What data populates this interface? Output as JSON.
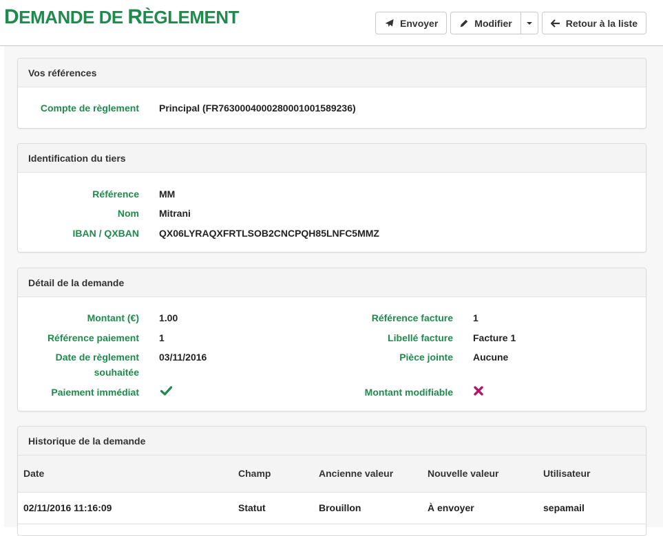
{
  "header": {
    "title_first": "D",
    "title_rest": "EMANDE DE ",
    "title_r": "R",
    "title_rest2": "ÈGLEMENT",
    "send_label": "Envoyer",
    "edit_label": "Modifier",
    "back_label": "Retour à la liste"
  },
  "references": {
    "title": "Vos références",
    "account_label": "Compte de règlement",
    "account_value": "Principal (FR7630004000280001001589236)"
  },
  "third_party": {
    "title": "Identification du tiers",
    "ref_label": "Référence",
    "ref_value": "MM",
    "name_label": "Nom",
    "name_value": "Mitrani",
    "iban_label": "IBAN / QXBAN",
    "iban_value": "QX06LYRAQXFRTLSOB2CNCPQH85LNFC5MMZ"
  },
  "detail": {
    "title": "Détail de la demande",
    "amount_label": "Montant (€)",
    "amount_value": "1.00",
    "pay_ref_label": "Référence paiement",
    "pay_ref_value": "1",
    "date_label_1": "Date de règlement",
    "date_label_2": "souhaitée",
    "date_value": "03/11/2016",
    "immediate_label": "Paiement immédiat",
    "invoice_ref_label": "Référence facture",
    "invoice_ref_value": "1",
    "invoice_label_label": "Libellé facture",
    "invoice_label_value": "Facture 1",
    "attachment_label": "Pièce jointe",
    "attachment_value": "Aucune",
    "editable_label": "Montant modifiable"
  },
  "history": {
    "title": "Historique de la demande",
    "columns": [
      "Date",
      "Champ",
      "Ancienne valeur",
      "Nouvelle valeur",
      "Utilisateur"
    ],
    "rows": [
      [
        "02/11/2016 11:16:09",
        "Statut",
        "Brouillon",
        "À envoyer",
        "sepamail"
      ]
    ]
  },
  "colors": {
    "accent": "#1e8a4c",
    "check": "#1e8a4c",
    "cross": "#b0176a"
  }
}
